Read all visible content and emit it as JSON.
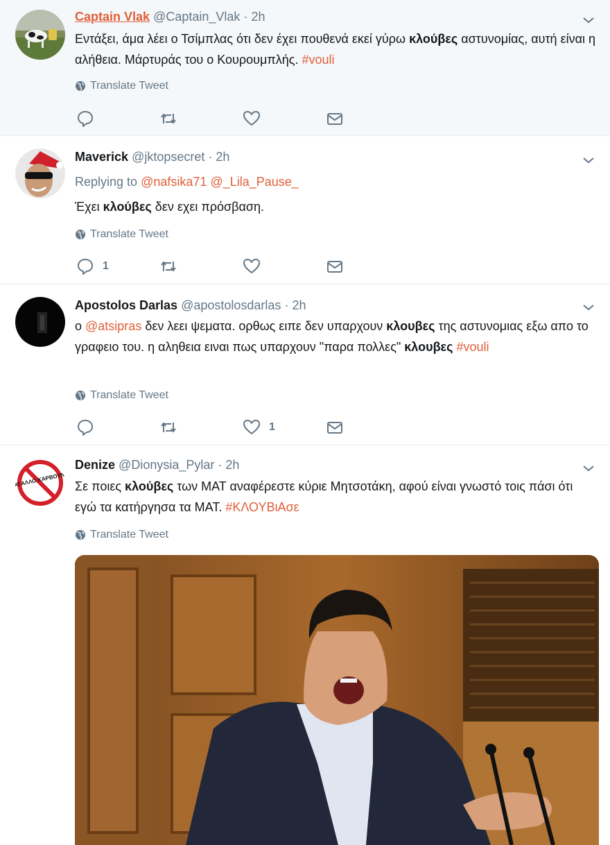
{
  "accent_color": "#e0603a",
  "translate_label": "Translate Tweet",
  "tweets": [
    {
      "name": "Captain Vlak",
      "handle": "@Captain_Vlak",
      "time": "2h",
      "text_parts": [
        "Εντάξει, άμα λέει ο Τσίμπλας ότι δεν έχει πουθενά εκεί γύρω ",
        "κλούβες",
        " αστυνομίας, αυτή είναι η αλήθεια. Μάρτυράς του ο Κουρουμπλής. ",
        "#vouli"
      ],
      "reply_count": "",
      "like_count": ""
    },
    {
      "name": "Maverick",
      "handle": "@jktopsecret",
      "time": "2h",
      "replying_label": "Replying to",
      "replying_to": [
        "@nafsika71",
        "@_Lila_Pause_"
      ],
      "text_parts": [
        "Έχει ",
        "κλούβες",
        " δεν εχει πρόσβαση."
      ],
      "reply_count": "1",
      "like_count": ""
    },
    {
      "name": "Apostolos Darlas",
      "handle": "@apostolosdarlas",
      "time": "2h",
      "text_parts": [
        "ο ",
        "@atsipras",
        " δεν λεει ψεματα. ορθως ειπε δεν υπαρχουν ",
        "κλουβες",
        " της αστυνομιας εξω απο το γραφειο του. η αληθεια ειναι πως υπαρχουν \"παρα πολλες\" ",
        "κλουβες",
        " ",
        "#vouli"
      ],
      "reply_count": "",
      "like_count": "1"
    },
    {
      "name": "Denize",
      "handle": "@Dionysia_Pylar",
      "time": "2h",
      "text_parts": [
        "Σε ποιες ",
        "κλούβες",
        " των ΜΑΤ αναφέρεστε κύριε Μητσοτάκη, αφού είναι γνωστό τοις πάσι ότι εγώ τα κατήργησα τα ΜΑΤ. ",
        "#ΚΛΟΥΒιΑσε"
      ],
      "avatar_text": "ΟΧΙ ΑΛΛΟ ΚΑΡΒΟΥΝΟ"
    }
  ]
}
